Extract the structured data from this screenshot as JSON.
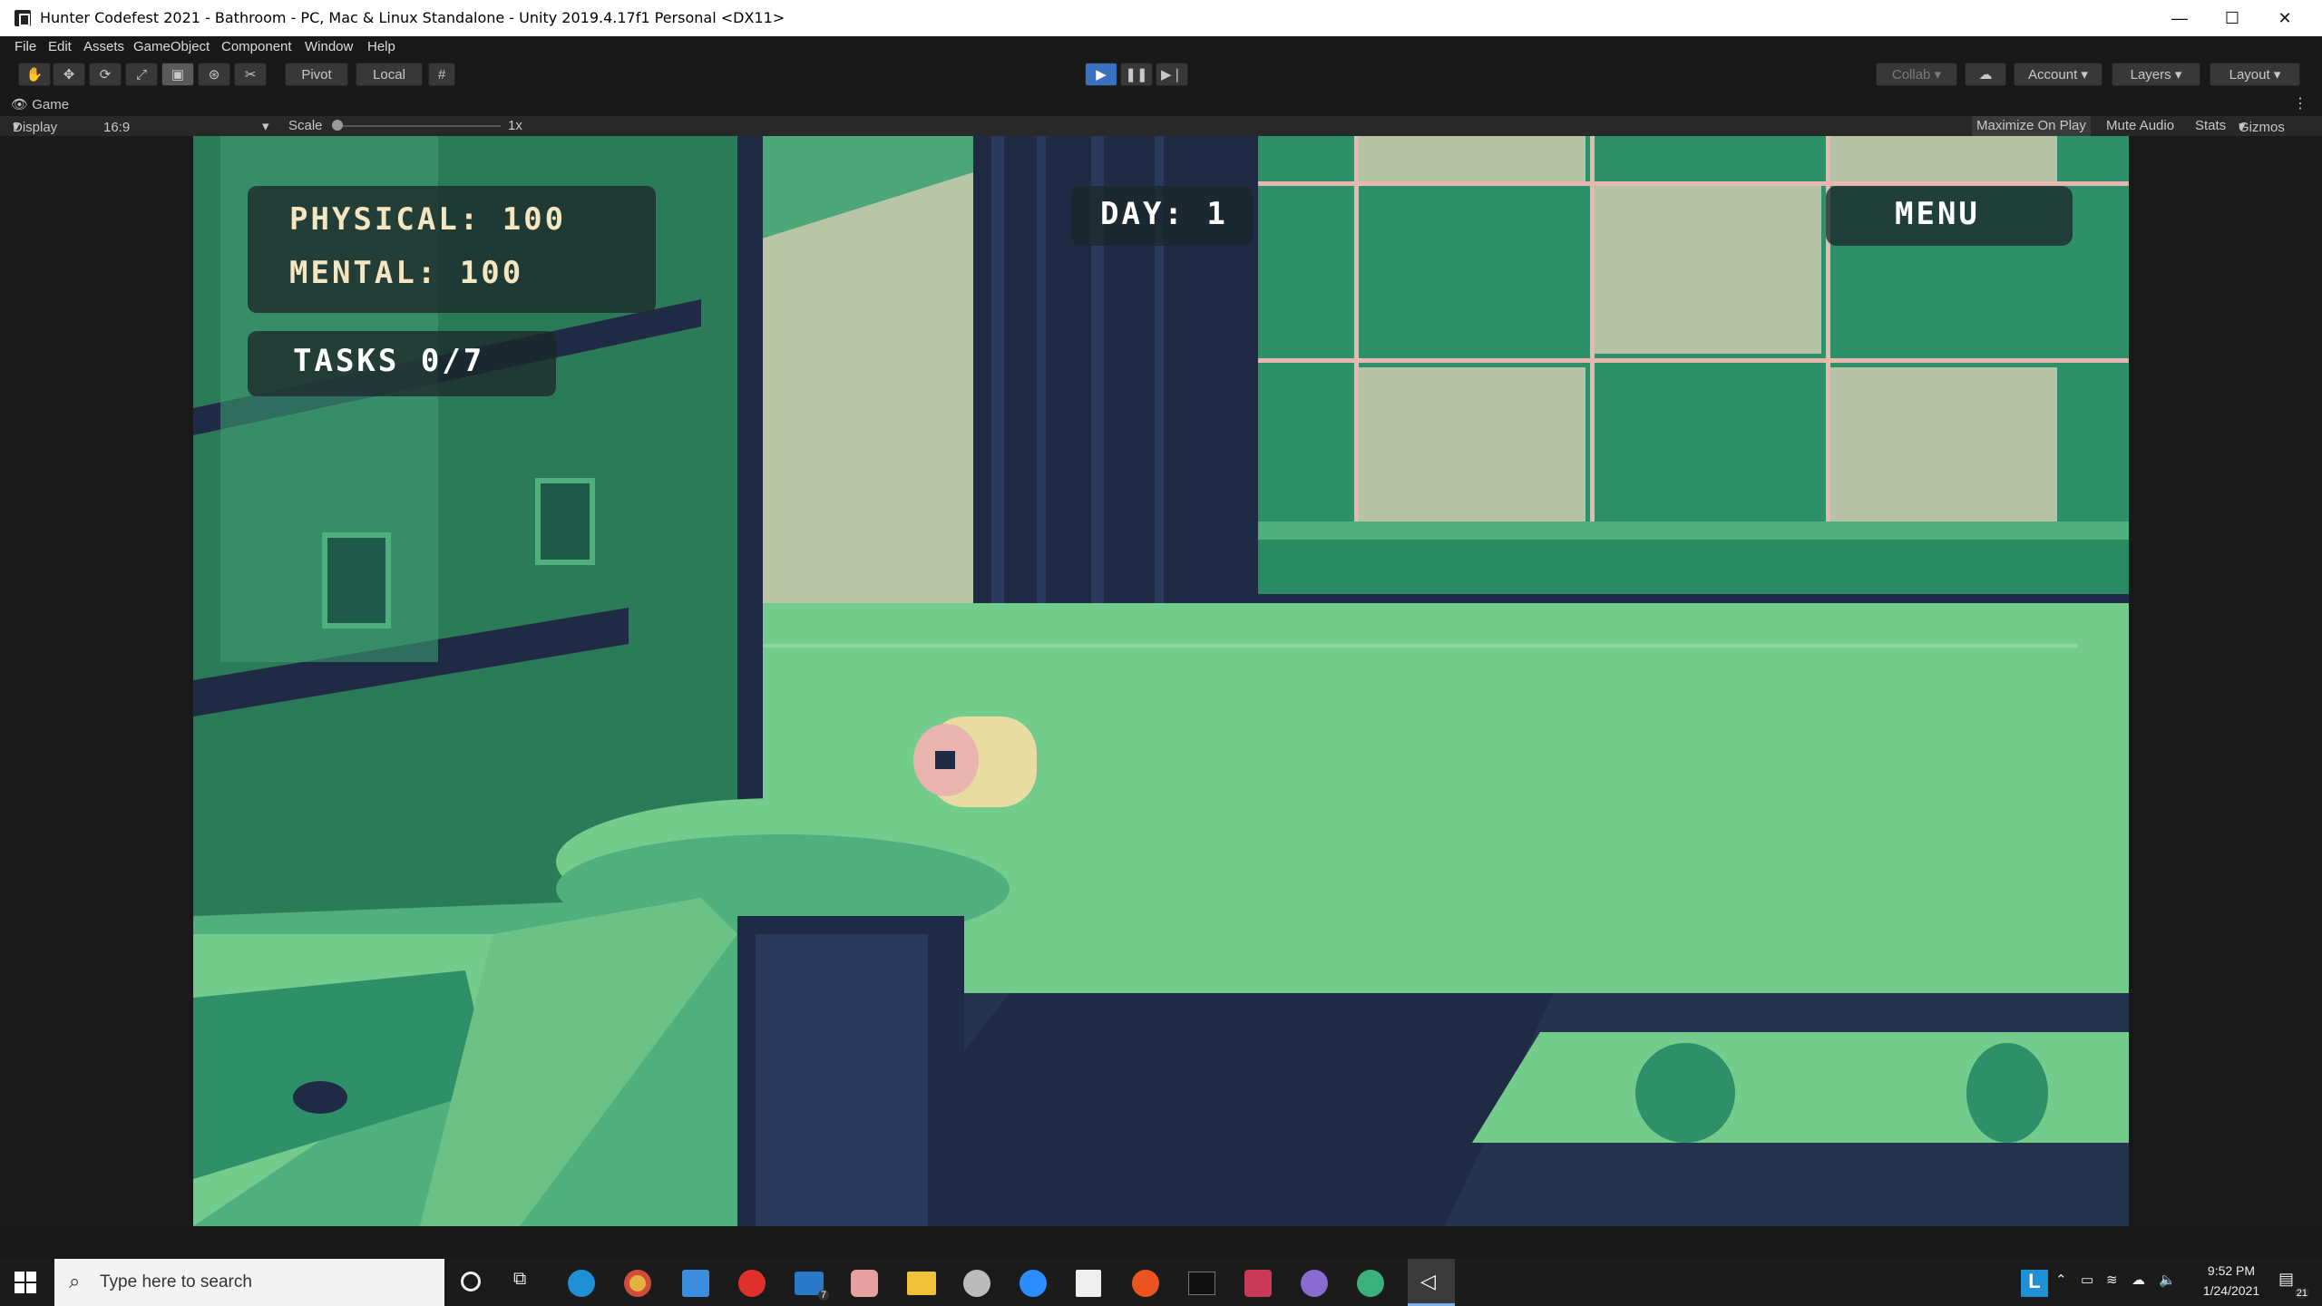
{
  "window": {
    "title": "Hunter Codefest 2021 - Bathroom - PC, Mac & Linux Standalone - Unity 2019.4.17f1 Personal <DX11>",
    "minimize": "—",
    "maximize": "☐",
    "close": "✕"
  },
  "menu": [
    "File",
    "Edit",
    "Assets",
    "GameObject",
    "Component",
    "Window",
    "Help"
  ],
  "toolbar": {
    "pivot": "Pivot",
    "local": "Local",
    "collab": "Collab",
    "account": "Account",
    "layers": "Layers",
    "layout": "Layout"
  },
  "tab": {
    "label": "Game"
  },
  "gamebar": {
    "display": "Display 1",
    "aspect": "16:9",
    "scale_label": "Scale",
    "scale_value": "1x",
    "maximize_on_play": "Maximize On Play",
    "mute_audio": "Mute Audio",
    "stats": "Stats",
    "gizmos": "Gizmos"
  },
  "hud": {
    "physical": "PHYSICAL: 100",
    "mental": "MENTAL: 100",
    "tasks": "TASKS 0/7",
    "day": "DAY: 1",
    "menu": "MENU"
  },
  "taskbar": {
    "search_placeholder": "Type here to search",
    "time": "9:52 PM",
    "date": "1/24/2021",
    "notifications": "21",
    "mail_badge": "7"
  },
  "colors": {
    "accent": "#3a70c2",
    "hud_text": "#f4e6c0",
    "scene_dark": "#1f2b45",
    "scene_green": "#74cc8c"
  }
}
